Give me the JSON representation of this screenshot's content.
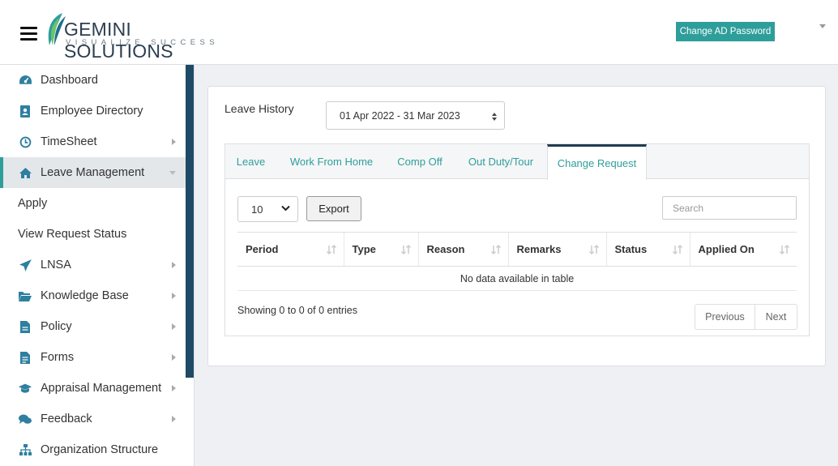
{
  "header": {
    "logo_text": "GEMINI SOLUTIONS",
    "logo_tagline": "VISUALIZE SUCCESS",
    "change_password_label": "Change AD Password",
    "accent_color": "#2e9e9b"
  },
  "sidebar": {
    "items": [
      {
        "label": "Dashboard",
        "icon": "dashboard-icon"
      },
      {
        "label": "Employee Directory",
        "icon": "address-book-icon"
      },
      {
        "label": "TimeSheet",
        "icon": "clock-icon"
      },
      {
        "label": "Leave Management",
        "icon": "home-icon"
      },
      {
        "label": "Apply"
      },
      {
        "label": "View Request Status"
      },
      {
        "label": "LNSA",
        "icon": "plane-icon"
      },
      {
        "label": "Knowledge Base",
        "icon": "folder-open-icon"
      },
      {
        "label": "Policy",
        "icon": "file-icon"
      },
      {
        "label": "Forms",
        "icon": "file-text-icon"
      },
      {
        "label": "Appraisal Management",
        "icon": "graduation-cap-icon"
      },
      {
        "label": "Feedback",
        "icon": "comments-icon"
      },
      {
        "label": "Organization Structure",
        "icon": "sitemap-icon"
      }
    ]
  },
  "main": {
    "leave_history_label": "Leave History",
    "financial_year": "01 Apr 2022 - 31 Mar 2023",
    "tabs": [
      {
        "label": "Leave"
      },
      {
        "label": "Work From Home"
      },
      {
        "label": "Comp Off"
      },
      {
        "label": "Out Duty/Tour"
      },
      {
        "label": "Change Request"
      }
    ],
    "active_tab": "Change Request",
    "page_length": "10",
    "export_label": "Export",
    "search_placeholder": "Search",
    "columns": [
      "Period",
      "Type",
      "Reason",
      "Remarks",
      "Status",
      "Applied On"
    ],
    "empty_message": "No data available in table",
    "info_text": "Showing 0 to 0 of 0 entries",
    "prev_label": "Previous",
    "next_label": "Next"
  }
}
